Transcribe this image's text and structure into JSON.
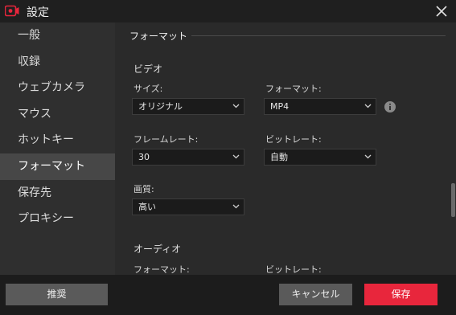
{
  "window": {
    "title": "設定",
    "app_icon": "record-camera-icon",
    "close_icon": "close-icon"
  },
  "sidebar": {
    "items": [
      {
        "label": "一般"
      },
      {
        "label": "収録"
      },
      {
        "label": "ウェブカメラ"
      },
      {
        "label": "マウス"
      },
      {
        "label": "ホットキー"
      },
      {
        "label": "フォーマット",
        "active": true
      },
      {
        "label": "保存先"
      },
      {
        "label": "プロキシー"
      }
    ]
  },
  "main": {
    "section_title": "フォーマット",
    "video": {
      "title": "ビデオ",
      "size": {
        "label": "サイズ:",
        "value": "オリジナル"
      },
      "format": {
        "label": "フォーマット:",
        "value": "MP4"
      },
      "frame_rate": {
        "label": "フレームレート:",
        "value": "30"
      },
      "bit_rate": {
        "label": "ビットレート:",
        "value": "自動"
      },
      "quality": {
        "label": "画質:",
        "value": "高い"
      }
    },
    "audio": {
      "title": "オーディオ",
      "format": {
        "label": "フォーマット:"
      },
      "bit_rate": {
        "label": "ビットレート:"
      }
    }
  },
  "footer": {
    "recommend": "推奨",
    "cancel": "キャンセル",
    "save": "保存"
  },
  "colors": {
    "accent": "#e8263c",
    "sidebar_bg": "#2f2f2f",
    "sidebar_active": "#474747",
    "main_bg": "#2a2a2a"
  }
}
